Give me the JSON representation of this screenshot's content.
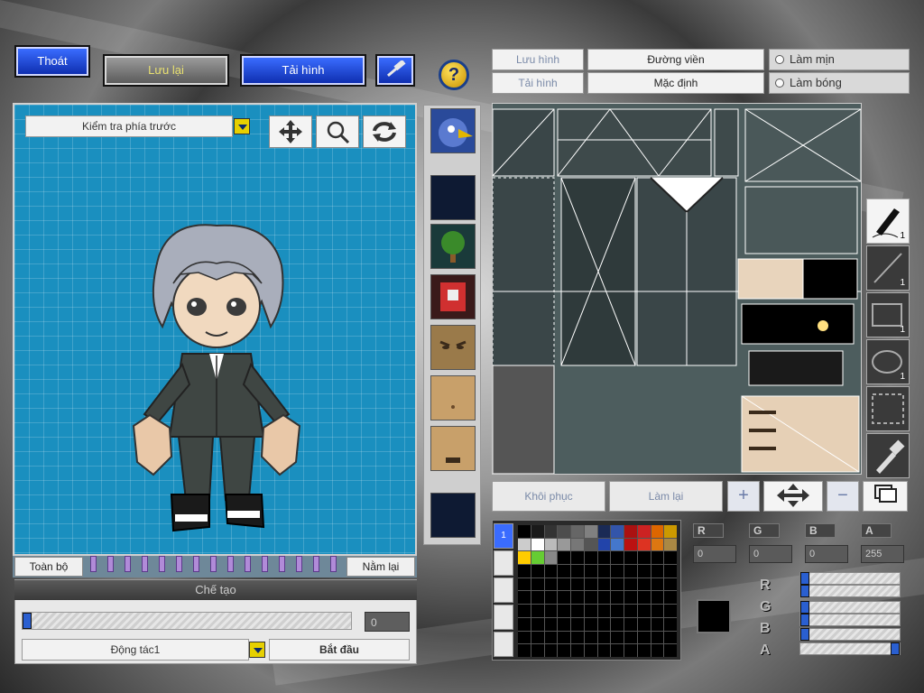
{
  "top_bar": {
    "exit_label": "Thoát",
    "save_label": "Lưu lại",
    "reload_label": "Tải hình",
    "help_symbol": "?"
  },
  "left_panel": {
    "view_select_value": "Kiểm tra phía trước",
    "all_label": "Toàn bộ",
    "lie_down_label": "Nằm lại"
  },
  "create_panel": {
    "title": "Chế tạo",
    "progress_value": "0",
    "action_select_value": "Động tác1",
    "start_label": "Bắt đầu"
  },
  "right_header": {
    "save_tab": "Lưu hình",
    "load_tab": "Tải hình",
    "outline_tab": "Đường viền",
    "default_tab": "Mặc định",
    "smooth_option": "Làm mịn",
    "shine_option": "Làm bóng"
  },
  "edit_actions": {
    "restore_label": "Khôi phục",
    "redo_label": "Làm lại",
    "plus_symbol": "+",
    "minus_symbol": "−"
  },
  "tools": {
    "pen_count": "1",
    "line_count": "1",
    "rect_count": "1",
    "ellipse_count": "1"
  },
  "color": {
    "r_label": "R",
    "g_label": "G",
    "b_label": "B",
    "a_label": "A",
    "r_value": "0",
    "g_value": "0",
    "b_value": "0",
    "a_value": "255",
    "current_hex": "#000000",
    "palette_tab_1": "1",
    "palette_row1": [
      "#000000",
      "#1a1a1a",
      "#333333",
      "#4d4d4d",
      "#666666",
      "#808080",
      "#1a2a55",
      "#3355aa",
      "#aa1111",
      "#cc2222",
      "#dd6600",
      "#cc9900"
    ],
    "palette_row2": [
      "#cccccc",
      "#ffffff",
      "#bbbbbb",
      "#999999",
      "#777777",
      "#555555",
      "#2244aa",
      "#4477cc",
      "#bb1111",
      "#dd3322",
      "#dd7711",
      "#aa8844"
    ],
    "palette_row3": [
      "#ffcc00",
      "#66cc33",
      "#888888"
    ],
    "r_slider": 0,
    "g_slider": 0,
    "b_slider": 0,
    "a_slider": 1
  }
}
